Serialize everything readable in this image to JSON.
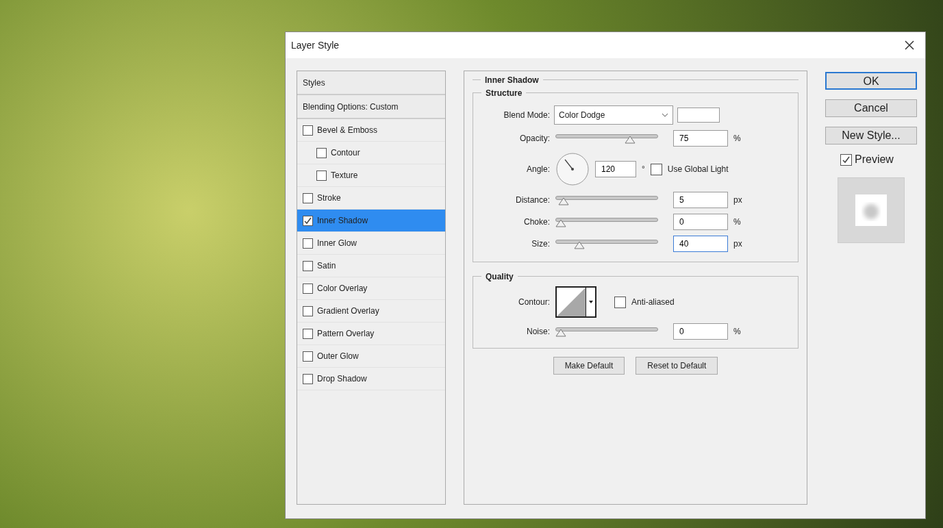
{
  "window": {
    "title": "Layer Style"
  },
  "styles_list": [
    {
      "kind": "header",
      "label": "Styles",
      "selected": false
    },
    {
      "kind": "header",
      "label": "Blending Options: Custom",
      "selected": false
    },
    {
      "kind": "effect",
      "label": "Bevel & Emboss",
      "checked": false,
      "selected": false,
      "children": [
        {
          "kind": "effect",
          "label": "Contour",
          "checked": false,
          "selected": false
        },
        {
          "kind": "effect",
          "label": "Texture",
          "checked": false,
          "selected": false
        }
      ]
    },
    {
      "kind": "effect",
      "label": "Stroke",
      "checked": false,
      "selected": false
    },
    {
      "kind": "effect",
      "label": "Inner Shadow",
      "checked": true,
      "selected": true
    },
    {
      "kind": "effect",
      "label": "Inner Glow",
      "checked": false,
      "selected": false
    },
    {
      "kind": "effect",
      "label": "Satin",
      "checked": false,
      "selected": false
    },
    {
      "kind": "effect",
      "label": "Color Overlay",
      "checked": false,
      "selected": false
    },
    {
      "kind": "effect",
      "label": "Gradient Overlay",
      "checked": false,
      "selected": false
    },
    {
      "kind": "effect",
      "label": "Pattern Overlay",
      "checked": false,
      "selected": false
    },
    {
      "kind": "effect",
      "label": "Outer Glow",
      "checked": false,
      "selected": false
    },
    {
      "kind": "effect",
      "label": "Drop Shadow",
      "checked": false,
      "selected": false
    }
  ],
  "section_title": "Inner Shadow",
  "structure": {
    "title": "Structure",
    "blend_mode": {
      "label": "Blend Mode:",
      "value": "Color Dodge"
    },
    "opacity": {
      "label": "Opacity:",
      "level": 0.75,
      "value": "75",
      "unit": "%"
    },
    "angle": {
      "label": "Angle:",
      "value": "120",
      "unit": "°",
      "global_light": {
        "label": "Use Global Light",
        "checked": false
      }
    },
    "sliders": [
      {
        "label": "Distance:",
        "level": 0.03,
        "value": "5",
        "unit": "px",
        "focused": false
      },
      {
        "label": "Choke:",
        "level": 0.0,
        "value": "0",
        "unit": "%",
        "focused": false
      },
      {
        "label": "Size:",
        "level": 0.2,
        "value": "40",
        "unit": "px",
        "focused": true
      }
    ]
  },
  "quality": {
    "title": "Quality",
    "contour": {
      "label": "Contour:",
      "anti_aliased": {
        "label": "Anti-aliased",
        "checked": false
      }
    },
    "noise": {
      "label": "Noise:",
      "level": 0.0,
      "value": "0",
      "unit": "%"
    }
  },
  "footer_buttons": [
    "Make Default",
    "Reset to Default"
  ],
  "side_buttons": [
    {
      "label": "OK",
      "default": true
    },
    {
      "label": "Cancel",
      "default": false
    },
    {
      "label": "New Style...",
      "default": false
    }
  ],
  "preview": {
    "label": "Preview",
    "checked": true
  }
}
